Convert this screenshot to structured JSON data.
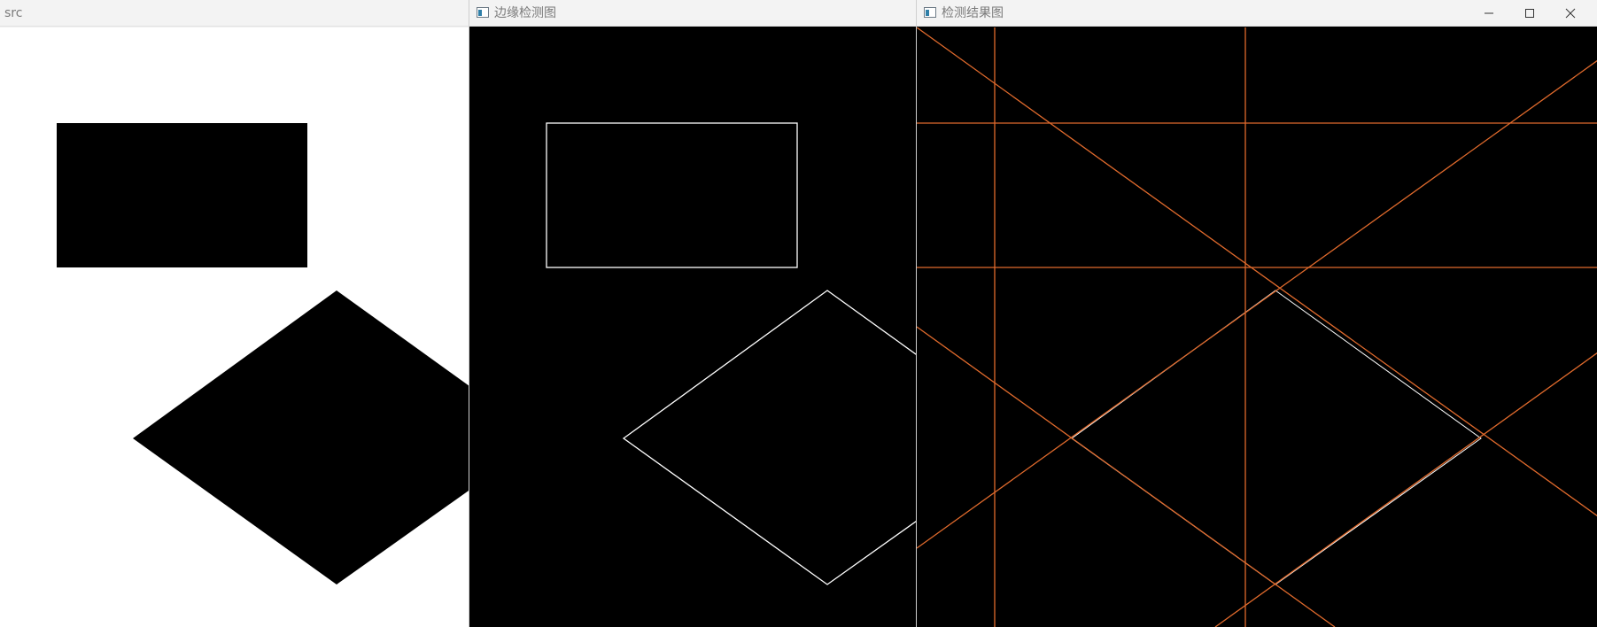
{
  "windows": {
    "src": {
      "title": "src"
    },
    "edges": {
      "title": "边缘检测图"
    },
    "result": {
      "title": "检测结果图"
    }
  },
  "window_controls": {
    "minimize_icon": "minimize-icon",
    "maximize_icon": "maximize-icon",
    "close_icon": "close-icon"
  },
  "colors": {
    "canvas_white": "#ffffff",
    "canvas_black": "#000000",
    "shape_black": "#000000",
    "edge_white": "#ffffff",
    "hough_line": "#e06a2c",
    "titlebar_bg": "#f3f3f3",
    "titlebar_text": "#7a7a7a"
  }
}
